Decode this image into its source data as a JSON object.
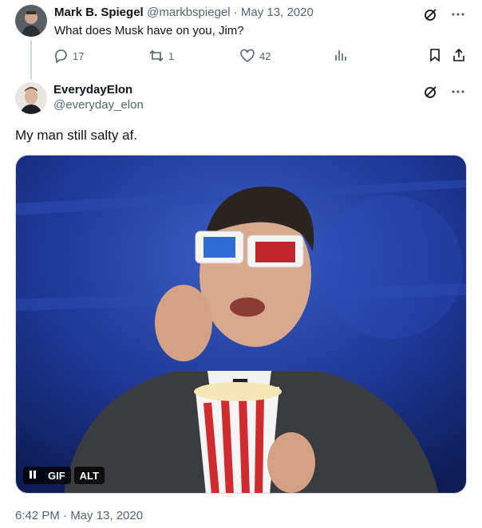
{
  "tweet1": {
    "author_name": "Mark B. Spiegel",
    "handle_and_date": "@markbspiegel · May 13, 2020",
    "text": "What does Musk have on you, Jim?",
    "stats": {
      "replies": "17",
      "retweets": "1",
      "likes": "42"
    }
  },
  "tweet2": {
    "author_name": "EverydayElon",
    "handle": "@everyday_elon",
    "text": "My man still salty af.",
    "media": {
      "gif_label": "GIF",
      "alt_label": "ALT"
    },
    "timestamp": "6:42 PM · May 13, 2020"
  },
  "colors": {
    "text": "#0f1419",
    "muted": "#536471",
    "border": "#cfd9de"
  },
  "icons": [
    "grok-icon",
    "more-icon",
    "reply-icon",
    "retweet-icon",
    "like-icon",
    "views-icon",
    "bookmark-icon",
    "share-icon",
    "pause-icon"
  ]
}
